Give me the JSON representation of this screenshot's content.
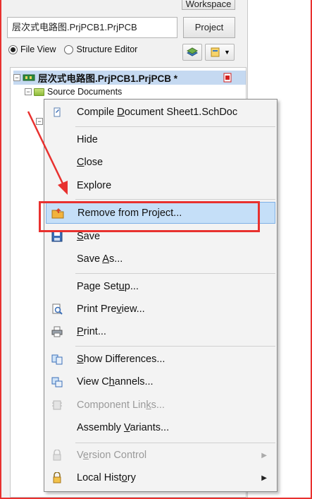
{
  "workspace_button": "Workspace",
  "project_field": "层次式电路图.PrjPCB1.PrjPCB",
  "project_button": "Project",
  "view_radio": {
    "file_view": "File View",
    "structure_editor": "Structure Editor",
    "selected": "file_view"
  },
  "tree": {
    "root_label": "层次式电路图.PrjPCB1.PrjPCB *",
    "source_docs": "Source Documents"
  },
  "menu": {
    "compile_pre": "Compile ",
    "compile_u": "D",
    "compile_post": "ocument Sheet1.SchDoc",
    "hide": "Hide",
    "close_u": "C",
    "close_rest": "lose",
    "explore": "Explore",
    "remove": "Remove from Project...",
    "save_u": "S",
    "save_rest": "ave",
    "saveas_pre": "Save ",
    "saveas_u": "A",
    "saveas_post": "s...",
    "pagesetup_pre": "Page Set",
    "pagesetup_u": "u",
    "pagesetup_post": "p...",
    "printpreview_pre": "Print Pre",
    "printpreview_u": "v",
    "printpreview_post": "iew...",
    "print_u": "P",
    "print_rest": "rint...",
    "showdiff_u": "S",
    "showdiff_rest": "how Differences...",
    "viewch_pre": "View C",
    "viewch_u": "h",
    "viewch_post": "annels...",
    "complinks_pre": "Component Lin",
    "complinks_u": "k",
    "complinks_post": "s...",
    "assembly_pre": "Assembly ",
    "assembly_u": "V",
    "assembly_post": "ariants...",
    "version_pre": "V",
    "version_u": "e",
    "version_post": "rsion Control",
    "localhist_pre": "Local Hist",
    "localhist_u": "o",
    "localhist_post": "ry"
  },
  "colors": {
    "annotation_red": "#e8312f",
    "highlight": "#c5dff8"
  }
}
